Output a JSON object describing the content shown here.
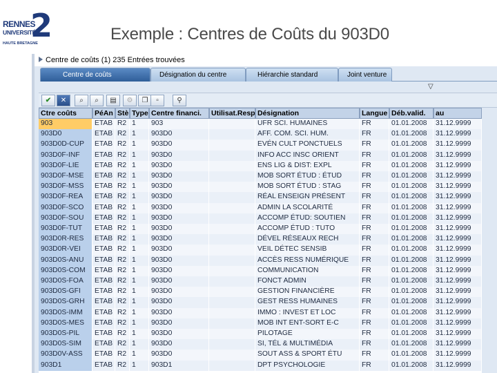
{
  "slide": {
    "title": "Exemple : Centres de Coûts du 903D0",
    "logo": {
      "line1": "RENNES",
      "line2": "UNIVERSITÉ",
      "line3": "HAUTE BRETAGNE",
      "numeral": "2"
    }
  },
  "sap": {
    "header_text": "Centre de coûts (1)  235 Entrées trouvées",
    "tabs": [
      {
        "label": "Centre de coûts",
        "active": true
      },
      {
        "label": "Désignation du centre",
        "active": false
      },
      {
        "label": "Hiérarchie standard",
        "active": false
      },
      {
        "label": "Joint venture",
        "active": false
      }
    ],
    "toolbar": {
      "icons": [
        "check-icon",
        "cancel-icon",
        "binoculars-icon",
        "find-next-icon",
        "export-icon",
        "settings-icon",
        "copy-icon",
        "info-icon",
        "filter-icon"
      ]
    },
    "columns": [
      "Ctre coûts",
      "PéAn",
      "Stè",
      "Type",
      "Centre financi.",
      "Utilisat.Resp",
      "Désignation",
      "Langue",
      "Déb.valid.",
      "au"
    ],
    "rows": [
      [
        "903",
        "ETAB",
        "R2",
        "1",
        "903",
        "",
        "UFR SCI. HUMAINES",
        "FR",
        "01.01.2008",
        "31.12.9999"
      ],
      [
        "903D0",
        "ETAB",
        "R2",
        "1",
        "903D0",
        "",
        "AFF. COM. SCI. HUM.",
        "FR",
        "01.01.2008",
        "31.12.9999"
      ],
      [
        "903D0D-CUP",
        "ETAB",
        "R2",
        "1",
        "903D0",
        "",
        "EVÉN CULT PONCTUELS",
        "FR",
        "01.01.2008",
        "31.12.9999"
      ],
      [
        "903D0F-INF",
        "ETAB",
        "R2",
        "1",
        "903D0",
        "",
        "INFO ACC INSC ORIENT",
        "FR",
        "01.01.2008",
        "31.12.9999"
      ],
      [
        "903D0F-LIE",
        "ETAB",
        "R2",
        "1",
        "903D0",
        "",
        "ENS LIG & DIST: EXPL",
        "FR",
        "01.01.2008",
        "31.12.9999"
      ],
      [
        "903D0F-MSE",
        "ETAB",
        "R2",
        "1",
        "903D0",
        "",
        "MOB SORT ÉTUD : ÉTUD",
        "FR",
        "01.01.2008",
        "31.12.9999"
      ],
      [
        "903D0F-MSS",
        "ETAB",
        "R2",
        "1",
        "903D0",
        "",
        "MOB SORT ÉTUD : STAG",
        "FR",
        "01.01.2008",
        "31.12.9999"
      ],
      [
        "903D0F-REA",
        "ETAB",
        "R2",
        "1",
        "903D0",
        "",
        "RÉAL ENSEIGN PRÉSENT",
        "FR",
        "01.01.2008",
        "31.12.9999"
      ],
      [
        "903D0F-SCO",
        "ETAB",
        "R2",
        "1",
        "903D0",
        "",
        "ADMIN LA SCOLARITÉ",
        "FR",
        "01.01.2008",
        "31.12.9999"
      ],
      [
        "903D0F-SOU",
        "ETAB",
        "R2",
        "1",
        "903D0",
        "",
        "ACCOMP ÉTUD: SOUTIEN",
        "FR",
        "01.01.2008",
        "31.12.9999"
      ],
      [
        "903D0F-TUT",
        "ETAB",
        "R2",
        "1",
        "903D0",
        "",
        "ACCOMP ÉTUD : TUTO",
        "FR",
        "01.01.2008",
        "31.12.9999"
      ],
      [
        "903D0R-RES",
        "ETAB",
        "R2",
        "1",
        "903D0",
        "",
        "DÉVEL RÉSEAUX RECH",
        "FR",
        "01.01.2008",
        "31.12.9999"
      ],
      [
        "903D0R-VEI",
        "ETAB",
        "R2",
        "1",
        "903D0",
        "",
        "VEIL DÉTEC SENSIB",
        "FR",
        "01.01.2008",
        "31.12.9999"
      ],
      [
        "903D0S-ANU",
        "ETAB",
        "R2",
        "1",
        "903D0",
        "",
        "ACCÈS RESS NUMÉRIQUE",
        "FR",
        "01.01.2008",
        "31.12.9999"
      ],
      [
        "903D0S-COM",
        "ETAB",
        "R2",
        "1",
        "903D0",
        "",
        "COMMUNICATION",
        "FR",
        "01.01.2008",
        "31.12.9999"
      ],
      [
        "903D0S-FOA",
        "ETAB",
        "R2",
        "1",
        "903D0",
        "",
        "FONCT ADMIN",
        "FR",
        "01.01.2008",
        "31.12.9999"
      ],
      [
        "903D0S-GFI",
        "ETAB",
        "R2",
        "1",
        "903D0",
        "",
        "GESTION FINANCIÈRE",
        "FR",
        "01.01.2008",
        "31.12.9999"
      ],
      [
        "903D0S-GRH",
        "ETAB",
        "R2",
        "1",
        "903D0",
        "",
        "GEST RESS HUMAINES",
        "FR",
        "01.01.2008",
        "31.12.9999"
      ],
      [
        "903D0S-IMM",
        "ETAB",
        "R2",
        "1",
        "903D0",
        "",
        "IMMO : INVEST ET LOC",
        "FR",
        "01.01.2008",
        "31.12.9999"
      ],
      [
        "903D0S-MES",
        "ETAB",
        "R2",
        "1",
        "903D0",
        "",
        "MOB INT ENT-SORT E-C",
        "FR",
        "01.01.2008",
        "31.12.9999"
      ],
      [
        "903D0S-PIL",
        "ETAB",
        "R2",
        "1",
        "903D0",
        "",
        "PILOTAGE",
        "FR",
        "01.01.2008",
        "31.12.9999"
      ],
      [
        "903D0S-SIM",
        "ETAB",
        "R2",
        "1",
        "903D0",
        "",
        "SI, TÉL & MULTIMÉDIA",
        "FR",
        "01.01.2008",
        "31.12.9999"
      ],
      [
        "903D0V-ASS",
        "ETAB",
        "R2",
        "1",
        "903D0",
        "",
        "SOUT ASS & SPORT ÉTU",
        "FR",
        "01.01.2008",
        "31.12.9999"
      ],
      [
        "903D1",
        "ETAB",
        "R2",
        "1",
        "903D1",
        "",
        "DPT PSYCHOLOGIE",
        "FR",
        "01.01.2008",
        "31.12.9999"
      ]
    ],
    "selected_row": 0,
    "colors": {
      "selected": "#ffcc66",
      "key_column": "#bad0eb",
      "tab_active": "#2f5e99"
    }
  }
}
